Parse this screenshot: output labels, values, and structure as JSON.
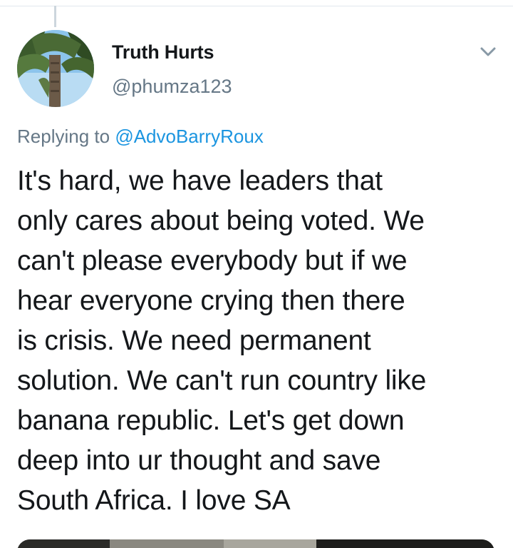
{
  "author": {
    "display_name": "Truth Hurts",
    "handle": "@phumza123",
    "avatar_icon": "palm-tree-avatar"
  },
  "reply": {
    "prefix": "Replying to ",
    "mention": "@AdvoBarryRoux"
  },
  "tweet": {
    "lines": [
      "It's hard, we have leaders that",
      "only cares about being voted. We",
      "can't please everybody but if we",
      "hear everyone crying then there",
      "is crisis. We need permanent",
      "solution. We can't run country like",
      "banana republic. Let's get down",
      "deep into ur thought and save",
      "South Africa. I love SA"
    ]
  },
  "icons": {
    "caret": "chevron-down-icon"
  },
  "colors": {
    "text": "#14171a",
    "secondary": "#657786",
    "link": "#1b95e0",
    "divider": "#e1e8ed"
  }
}
